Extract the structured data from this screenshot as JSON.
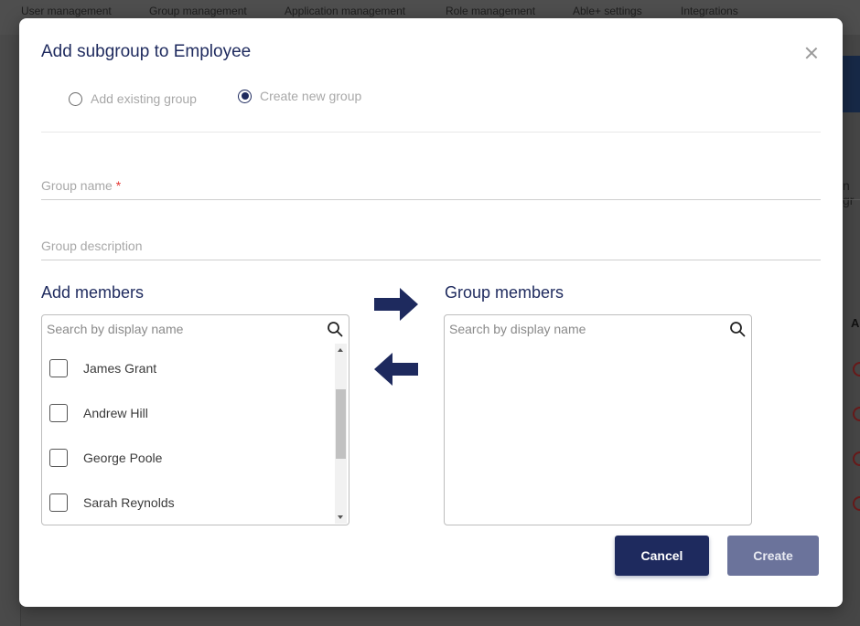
{
  "background": {
    "nav_items": [
      "User management",
      "Group management",
      "Application management",
      "Role management",
      "Able+ settings",
      "Integrations"
    ],
    "partial_text": "n gr",
    "partial_column_header": "A"
  },
  "dialog": {
    "title": "Add subgroup to Employee",
    "close_icon": "close-icon",
    "mode_options": [
      {
        "label": "Add existing group",
        "selected": false
      },
      {
        "label": "Create new group",
        "selected": true
      }
    ],
    "fields": {
      "group_name": {
        "label": "Group name",
        "required_marker": "*",
        "value": ""
      },
      "group_description": {
        "label": "Group description",
        "value": ""
      }
    },
    "add_members": {
      "title": "Add members",
      "search_placeholder": "Search by display name",
      "items": [
        {
          "name": "James Grant",
          "checked": false
        },
        {
          "name": "Andrew Hill",
          "checked": false
        },
        {
          "name": "George Poole",
          "checked": false
        },
        {
          "name": "Sarah Reynolds",
          "checked": false
        }
      ]
    },
    "group_members": {
      "title": "Group members",
      "search_placeholder": "Search by display name",
      "items": []
    },
    "transfer_icons": {
      "add": "arrow-right-icon",
      "remove": "arrow-left-icon"
    },
    "buttons": {
      "cancel": "Cancel",
      "create": "Create"
    },
    "colors": {
      "primary": "#1e2a5e",
      "disabled_primary": "#6b739b",
      "required": "#e53935"
    }
  }
}
